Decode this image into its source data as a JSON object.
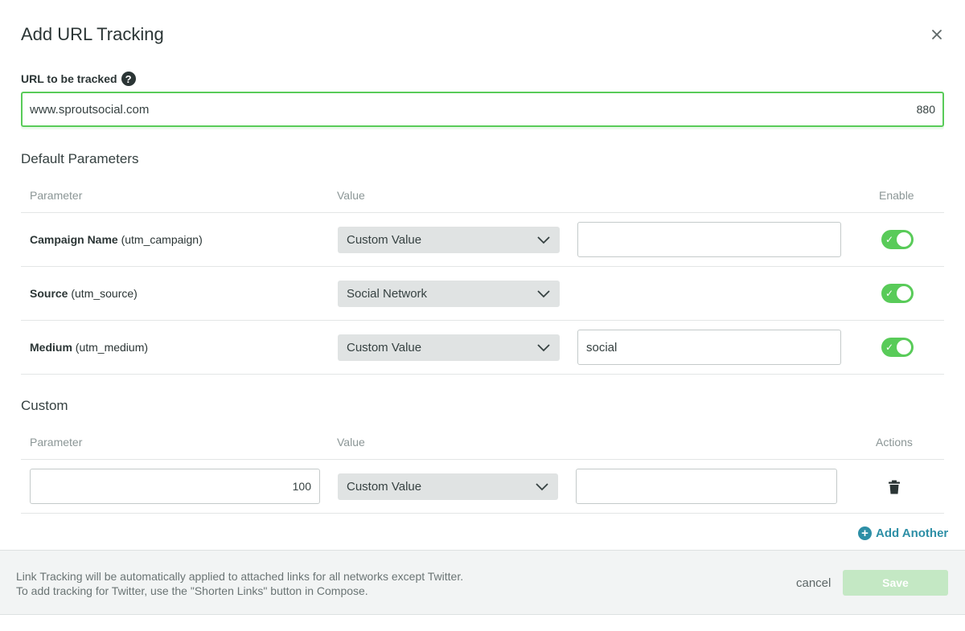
{
  "dialog": {
    "title": "Add URL Tracking"
  },
  "url": {
    "label": "URL to be tracked",
    "value": "www.sproutsocial.com",
    "char_count": "880"
  },
  "default_params": {
    "section_title": "Default Parameters",
    "headers": {
      "parameter": "Parameter",
      "value": "Value",
      "enable": "Enable"
    },
    "rows": [
      {
        "name": "Campaign Name",
        "key": "(utm_campaign)",
        "select": "Custom Value",
        "input": "",
        "enabled": true
      },
      {
        "name": "Source",
        "key": "(utm_source)",
        "select": "Social Network",
        "enabled": true
      },
      {
        "name": "Medium",
        "key": "(utm_medium)",
        "select": "Custom Value",
        "input": "social",
        "enabled": true
      }
    ]
  },
  "custom": {
    "section_title": "Custom",
    "headers": {
      "parameter": "Parameter",
      "value": "Value",
      "actions": "Actions"
    },
    "rows": [
      {
        "param_count": "100",
        "select": "Custom Value",
        "input": ""
      }
    ],
    "add_another": "Add Another"
  },
  "footer": {
    "note_line1": "Link Tracking will be automatically applied to attached links for all networks except Twitter.",
    "note_line2": "To add tracking for Twitter, use the \"Shorten Links\" button in Compose.",
    "cancel_label": "cancel",
    "save_label": "Save"
  },
  "colors": {
    "accent_green": "#59cb59",
    "link_blue": "#2d8fa6",
    "save_disabled": "#c4e8c4"
  }
}
